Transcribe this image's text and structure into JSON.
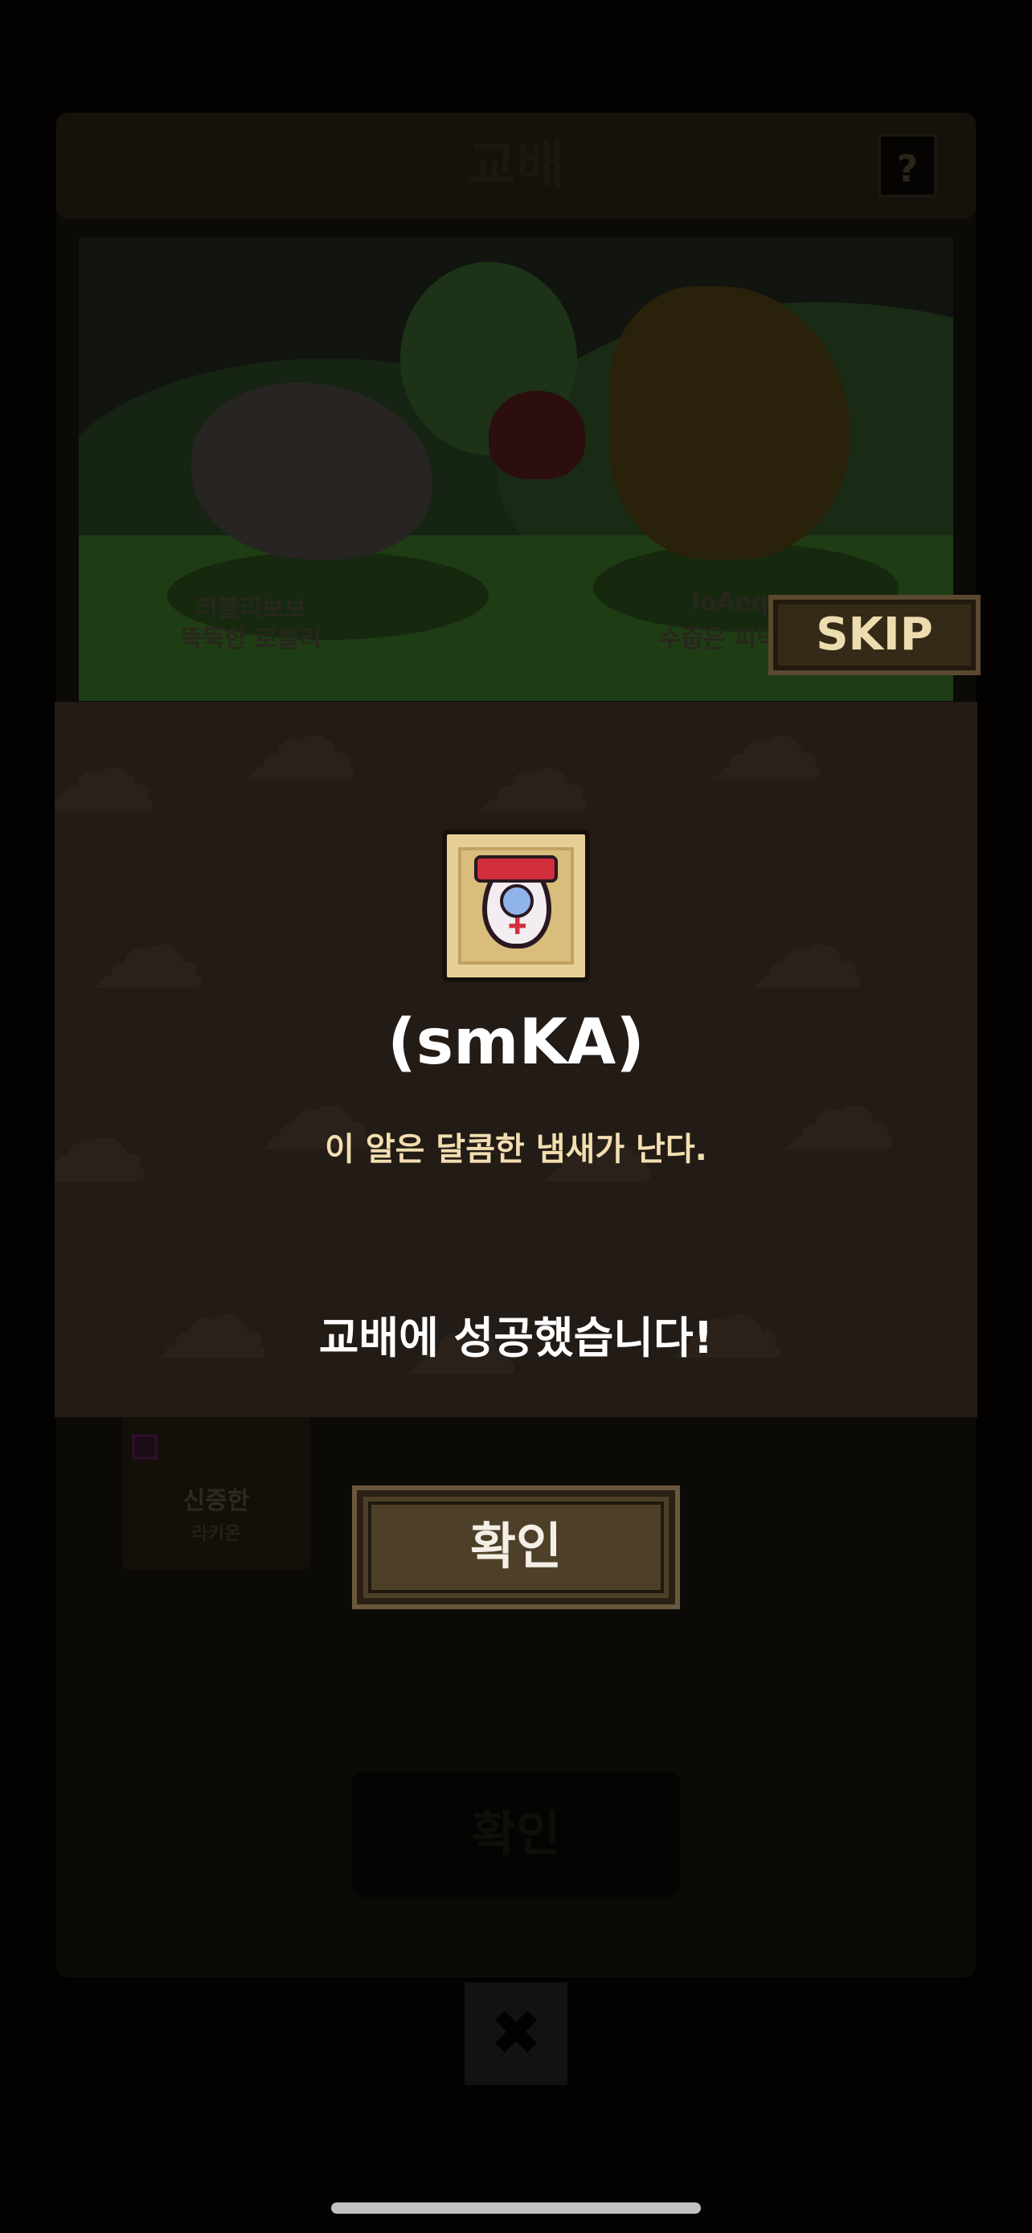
{
  "window": {
    "title": "교배",
    "help_label": "?"
  },
  "scene": {
    "left_monster": {
      "name": "러블리보보",
      "trait": "뚝뚝한 로블리"
    },
    "right_monster": {
      "name": "IoAeq",
      "trait": "수줍은 피닉스"
    },
    "skip_label": "SKIP"
  },
  "selected_card": {
    "name": "신중한",
    "sub": "라키온"
  },
  "background_confirm_label": "확인",
  "close_label": "✖",
  "result_modal": {
    "egg_name": "(smKA)",
    "egg_description": "이 알은 달콤한 냄새가 난다.",
    "success_message": "교배에 성공했습니다!",
    "confirm_label": "확인"
  },
  "colors": {
    "modal_bg": "#231b16",
    "button_brown": "#4e3f28",
    "description_text": "#f2deb0",
    "skip_text": "#eddcaf"
  }
}
